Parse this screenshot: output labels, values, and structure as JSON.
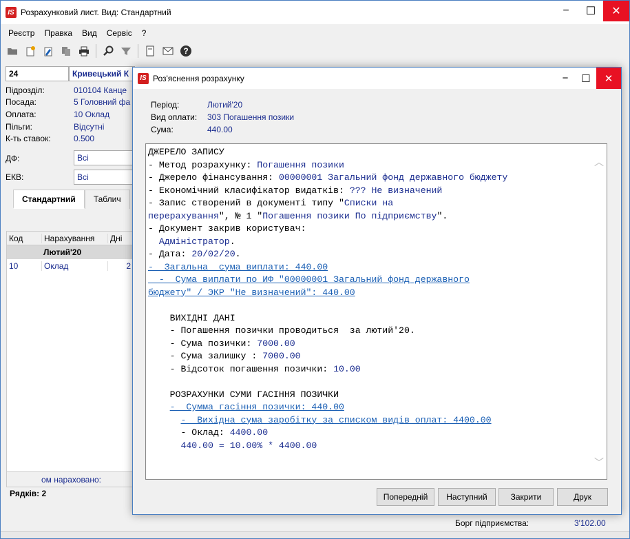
{
  "window": {
    "title": "Розрахунковий лист. Вид: Стандартний",
    "logo": "IS",
    "minimize_glyph": "−",
    "maximize_glyph": "☐",
    "close_glyph": "✕"
  },
  "menu": [
    "Реєстр",
    "Правка",
    "Вид",
    "Сервіс",
    "?"
  ],
  "toolbar_icons": [
    "folder-icon",
    "new-doc-icon",
    "edit-doc-icon",
    "copy-icon",
    "print-icon",
    "search-icon",
    "filter-icon",
    "document-icon",
    "mail-icon",
    "help-icon"
  ],
  "employee": {
    "tab_number": "24",
    "name": "Кривецький К",
    "labels": {
      "dept": "Підрозділ:",
      "position": "Посада:",
      "payment": "Оплата:",
      "benefits": "Пільги:",
      "rate": "К-ть ставок:",
      "df": "ДФ:",
      "ekv": "ЕКВ:"
    },
    "dept": "010104  Канце",
    "position": "5  Головний фа",
    "payment": "10 Оклад",
    "benefits": "Відсутні",
    "rate": "0.500",
    "df": "Всі",
    "ekv": "Всі"
  },
  "tabs": [
    "Стандартний",
    "Таблич"
  ],
  "grid": {
    "headers": [
      "Код",
      "Нарахування",
      "Дні"
    ],
    "group": "Лютий'20",
    "row": {
      "code": "10",
      "name": "Оклад",
      "days": "2"
    },
    "footer": "ом нараховано:"
  },
  "rows_count": "Рядків: 2",
  "debt": {
    "label": "Борг підприємства:",
    "value": "3'102.00"
  },
  "dialog": {
    "title": "Роз'яснення розрахунку",
    "logo": "IS",
    "labels": {
      "period": "Період:",
      "pay_type": "Вид оплати:",
      "amount": "Сума:"
    },
    "period": "Лютий'20",
    "pay_type": "303 Погашення позики",
    "amount": "440.00",
    "text": {
      "l1": "ДЖЕРЕЛО ЗАПИСУ",
      "l2a": "- Метод розрахунку: ",
      "l2b": "Погашення позики",
      "l3a": "- Джерело фінансування: ",
      "l3b": "00000001 Загальний фонд державного бюджету",
      "l4a": "- Економічний класифікатор видатків: ",
      "l4b": "??? Не визначений",
      "l5a": "- Запис створений в документі типу \"",
      "l5b": "Списки на",
      "l6a": "перерахування",
      "l6b": "\", № 1 \"",
      "l6c": "Погашення позики По підприємству",
      "l6d": "\".",
      "l7": "- Документ закрив користувач:",
      "l8a": "  ",
      "l8b": "Адміністратор",
      "l8c": ".",
      "l9a": "- Дата: ",
      "l9b": "20/02/20",
      "l9c": ".",
      "l10": "-  Загальна  сума виплати: 440.00",
      "l11": "  -  Сума виплати по ИФ \"00000001 Загальний фонд державного",
      "l12": "бюджету\" / ЭКР \"Не визначений\": 440.00",
      "l13": "    ВИХІДНІ ДАНІ",
      "l14": "    - Погашення позички проводиться  за лютий'20.",
      "l15a": "    - Сума позички: ",
      "l15b": "7000.00",
      "l16a": "    - Сума залишку : ",
      "l16b": "7000.00",
      "l17a": "    - Вiдсоток погашення позички: ",
      "l17b": "10.00",
      "l18": "    РОЗРАХУНКИ СУМИ ГАСІННЯ ПОЗИЧКИ",
      "l19": "-  Сумма гасіння позички: 440.00",
      "l20": "-  Вихідна сума заробітку за списком видів оплат: 4400.00",
      "l21a": "      - Оклад: ",
      "l21b": "4400.00",
      "l22a": "      ",
      "l22b": "440.00 = 10.00% * 4400.00"
    },
    "buttons": {
      "prev": "Попередній",
      "next": "Наступний",
      "close": "Закрити",
      "print": "Друк"
    }
  },
  "colors": {
    "accent": "#1a2c8f",
    "link": "#1a5fb4",
    "close_red": "#e81123",
    "logo_red": "#d32020"
  }
}
